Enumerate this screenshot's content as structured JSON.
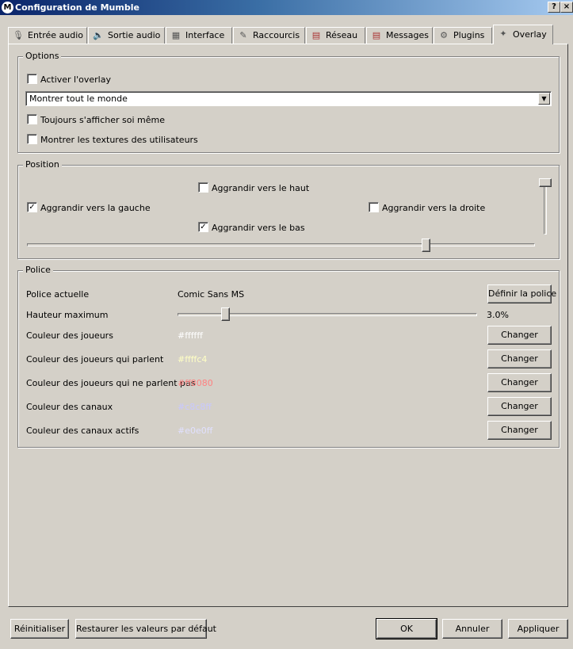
{
  "window": {
    "title": "Configuration de Mumble",
    "help_label": "?",
    "close_label": "×"
  },
  "tabs": [
    {
      "label": "Entrée audio",
      "icon": "microphone-icon"
    },
    {
      "label": "Sortie audio",
      "icon": "speaker-icon"
    },
    {
      "label": "Interface",
      "icon": "interface-icon"
    },
    {
      "label": "Raccourcis",
      "icon": "shortcuts-icon"
    },
    {
      "label": "Réseau",
      "icon": "network-icon"
    },
    {
      "label": "Messages",
      "icon": "messages-icon"
    },
    {
      "label": "Plugins",
      "icon": "plugins-icon"
    },
    {
      "label": "Overlay",
      "icon": "overlay-icon"
    }
  ],
  "active_tab": "Overlay",
  "options": {
    "title": "Options",
    "enable_overlay": {
      "label": "Activer l'overlay",
      "checked": false
    },
    "show_select": {
      "value": "Montrer tout le monde"
    },
    "always_self": {
      "label": "Toujours s'afficher soi même",
      "checked": false
    },
    "show_textures": {
      "label": "Montrer les textures des utilisateurs",
      "checked": false
    }
  },
  "position": {
    "title": "Position",
    "grow_up": {
      "label": "Aggrandir vers le haut",
      "checked": false
    },
    "grow_left": {
      "label": "Aggrandir vers la gauche",
      "checked": true
    },
    "grow_right": {
      "label": "Aggrandir vers la droite",
      "checked": false
    },
    "grow_down": {
      "label": "Aggrandir vers le bas",
      "checked": true
    },
    "x_slider": 0.79,
    "y_slider": 0.0
  },
  "font": {
    "title": "Police",
    "current_label": "Police actuelle",
    "current_value": "Comic Sans MS",
    "set_font_button": "Définir la police",
    "max_height_label": "Hauteur maximum",
    "max_height_slider": 0.15,
    "max_height_value": "3.0%",
    "change_label": "Changer",
    "colors": [
      {
        "label": "Couleur des joueurs",
        "value": "#ffffff",
        "color": "#ffffff"
      },
      {
        "label": "Couleur des joueurs qui parlent",
        "value": "#ffffc4",
        "color": "#ffffc4"
      },
      {
        "label": "Couleur des joueurs qui ne parlent pas",
        "value": "#ff8080",
        "color": "#ff8080"
      },
      {
        "label": "Couleur des canaux",
        "value": "#c8c8ff",
        "color": "#c8c8ff"
      },
      {
        "label": "Couleur des canaux actifs",
        "value": "#e0e0ff",
        "color": "#e0e0ff"
      }
    ]
  },
  "footer": {
    "reset": "Réinitialiser",
    "restore_defaults": "Restaurer les valeurs par défaut",
    "ok": "OK",
    "cancel": "Annuler",
    "apply": "Appliquer"
  }
}
